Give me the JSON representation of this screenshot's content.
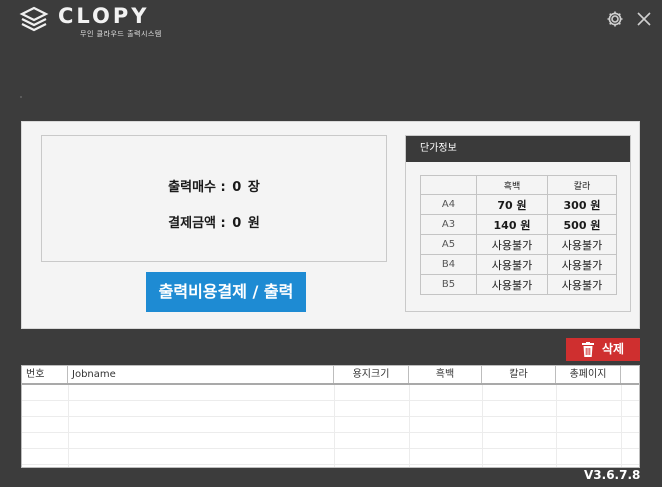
{
  "app": {
    "brand": "CLOPY",
    "tagline": "무인 클라우드 출력시스템",
    "version": "V3.6.7.8"
  },
  "summary": {
    "print_count_label": "출력매수 :",
    "print_count_value": "0",
    "print_count_unit": "장",
    "amount_label": "결제금액 :",
    "amount_value": "0",
    "amount_unit": "원"
  },
  "pay_button_label": "출력비용결제 / 출력",
  "price_info": {
    "title": "단가정보",
    "columns": [
      "",
      "흑백",
      "칼라"
    ],
    "rows": [
      {
        "size": "A4",
        "bw": "70 원",
        "color": "300 원"
      },
      {
        "size": "A3",
        "bw": "140 원",
        "color": "500 원"
      },
      {
        "size": "A5",
        "bw": "사용불가",
        "color": "사용불가"
      },
      {
        "size": "B4",
        "bw": "사용불가",
        "color": "사용불가"
      },
      {
        "size": "B5",
        "bw": "사용불가",
        "color": "사용불가"
      }
    ]
  },
  "delete_button_label": "삭제",
  "jobs_table": {
    "columns": [
      "번호",
      "Jobname",
      "용지크기",
      "흑백",
      "칼라",
      "총페이지"
    ],
    "rows": []
  },
  "colors": {
    "background": "#3c3c3c",
    "pay_button": "#1e8bd3",
    "delete_button": "#cf2f2f",
    "price_header": "#3a3a3a"
  },
  "icons": {
    "logo": "stacked-layers-logo",
    "settings": "gear-icon",
    "close": "close-icon",
    "delete": "trash-icon"
  }
}
